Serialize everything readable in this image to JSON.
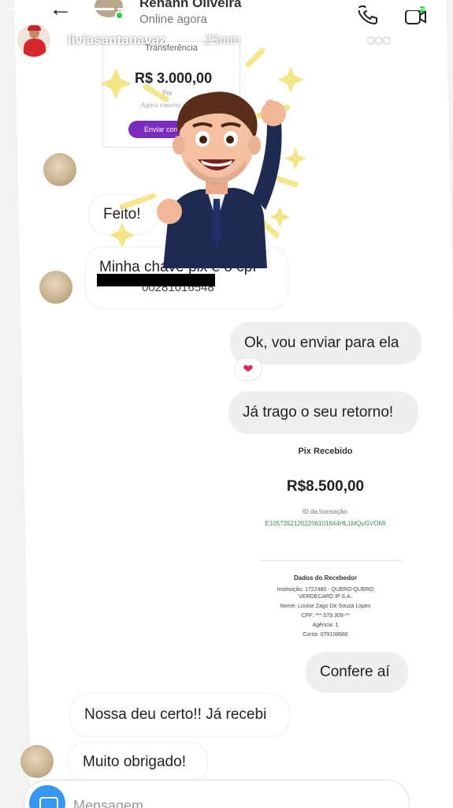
{
  "story": {
    "username": "liviasantanavaz",
    "time_ago": "25min",
    "progress_fractions": [
      1,
      1,
      1,
      1,
      1,
      1,
      1,
      0.5
    ]
  },
  "chat_header": {
    "contact_name": "Renann Oliveira",
    "status": "Online agora"
  },
  "top_receipt": {
    "title": "Transferência",
    "amount": "R$ 3.000,00",
    "sub": "Pix",
    "time": "Agora mesmo",
    "button": "Enviar comprovante"
  },
  "messages": [
    {
      "side": "in",
      "text": "Feito!"
    },
    {
      "side": "in",
      "text": "Minha chave pix é o cpf"
    },
    {
      "side": "out",
      "text": "Ok, vou enviar para ela"
    },
    {
      "side": "out",
      "text": "Já trago o seu retorno!"
    },
    {
      "side": "out",
      "text": "Confere aí"
    },
    {
      "side": "in",
      "text": "Nossa deu certo!! Já recebi"
    },
    {
      "side": "in",
      "text": "Muito obrigado!"
    }
  ],
  "pix_partial": "00281016548",
  "reaction": "❤",
  "pix_receipt": {
    "title": "Pix Recebido",
    "amount": "R$8.500,00",
    "id_label": "ID da transação:",
    "id_value": "E10573521202206101644HL1MQuGVOMI",
    "dest_title": "Dados do Recebedor",
    "dest_lines": [
      "Instituição: 1722480 - QUERO-QUERO",
      "VERDECARD IP S.A.",
      "Nome: Louise Zago De Souza Lopes",
      "CPF: ***.079.309-**",
      "Agência: 1",
      "Conta: 079108686"
    ]
  },
  "composer": {
    "placeholder": "Mensagem..."
  },
  "colors": {
    "accent_blue": "#3797f0",
    "online_green": "#27c93f",
    "heart": "#e0245e",
    "purple_button": "#7b2cbf"
  }
}
